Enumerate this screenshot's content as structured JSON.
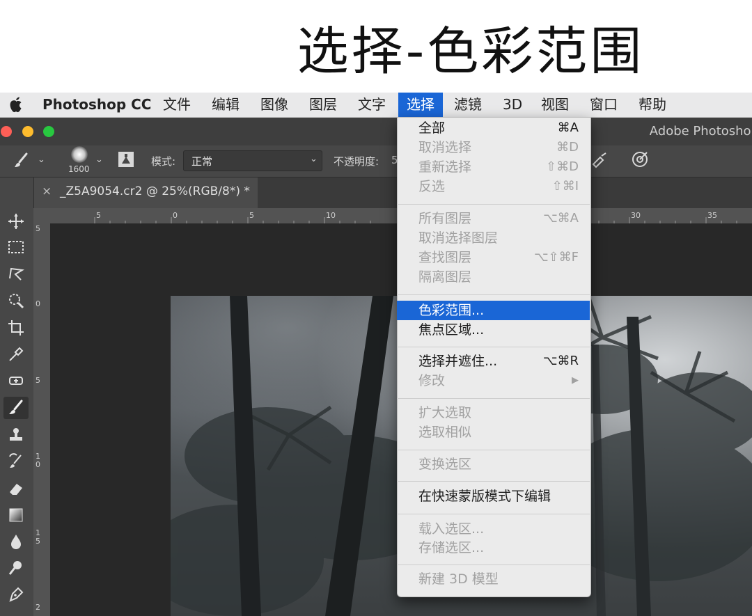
{
  "heading": "选择-色彩范围",
  "menubar": {
    "app_name": "Photoshop CC",
    "items": [
      "文件",
      "编辑",
      "图像",
      "图层",
      "文字",
      "选择",
      "滤镜",
      "3D",
      "视图",
      "窗口",
      "帮助"
    ],
    "active_index": 5
  },
  "window": {
    "title": "Adobe Photoshop",
    "traffic_lights": {
      "close": "#fe5f57",
      "minimize": "#febc2e",
      "zoom": "#28c840"
    }
  },
  "options_bar": {
    "brush_size": "1600",
    "mode_label": "模式:",
    "mode_value": "正常",
    "opacity_label": "不透明度:",
    "opacity_value": "5"
  },
  "document_tab": {
    "close": "×",
    "title": "_Z5A9054.cr2 @ 25%(RGB/8*) *"
  },
  "rulers": {
    "horizontal": [
      "5",
      "0",
      "5",
      "10",
      "30",
      "35"
    ],
    "vertical": [
      "5",
      "0",
      "5",
      "1 0",
      "1 5",
      "2"
    ]
  },
  "tools": [
    "move-tool",
    "marquee-tool",
    "lasso-tool",
    "quick-selection-tool",
    "crop-tool",
    "eyedropper-tool",
    "healing-brush-tool",
    "brush-tool",
    "clone-stamp-tool",
    "history-brush-tool",
    "eraser-tool",
    "gradient-tool",
    "blur-tool",
    "dodge-tool",
    "pen-tool"
  ],
  "select_menu": {
    "items": [
      {
        "label": "全部",
        "shortcut": "⌘A",
        "enabled": true
      },
      {
        "label": "取消选择",
        "shortcut": "⌘D",
        "enabled": false
      },
      {
        "label": "重新选择",
        "shortcut": "⇧⌘D",
        "enabled": false
      },
      {
        "label": "反选",
        "shortcut": "⇧⌘I",
        "enabled": false
      },
      {
        "label": "所有图层",
        "shortcut": "⌥⌘A",
        "enabled": false
      },
      {
        "label": "取消选择图层",
        "shortcut": "",
        "enabled": false
      },
      {
        "label": "查找图层",
        "shortcut": "⌥⇧⌘F",
        "enabled": false
      },
      {
        "label": "隔离图层",
        "shortcut": "",
        "enabled": false
      },
      {
        "label": "色彩范围...",
        "shortcut": "",
        "enabled": true,
        "highlighted": true
      },
      {
        "label": "焦点区域...",
        "shortcut": "",
        "enabled": true
      },
      {
        "label": "选择并遮住...",
        "shortcut": "⌥⌘R",
        "enabled": true
      },
      {
        "label": "修改",
        "shortcut": "▶",
        "enabled": false
      },
      {
        "label": "扩大选取",
        "shortcut": "",
        "enabled": false
      },
      {
        "label": "选取相似",
        "shortcut": "",
        "enabled": false
      },
      {
        "label": "变换选区",
        "shortcut": "",
        "enabled": false
      },
      {
        "label": "在快速蒙版模式下编辑",
        "shortcut": "",
        "enabled": true
      },
      {
        "label": "载入选区...",
        "shortcut": "",
        "enabled": false
      },
      {
        "label": "存储选区...",
        "shortcut": "",
        "enabled": false
      },
      {
        "label": "新建 3D 模型",
        "shortcut": "",
        "enabled": false
      }
    ]
  }
}
